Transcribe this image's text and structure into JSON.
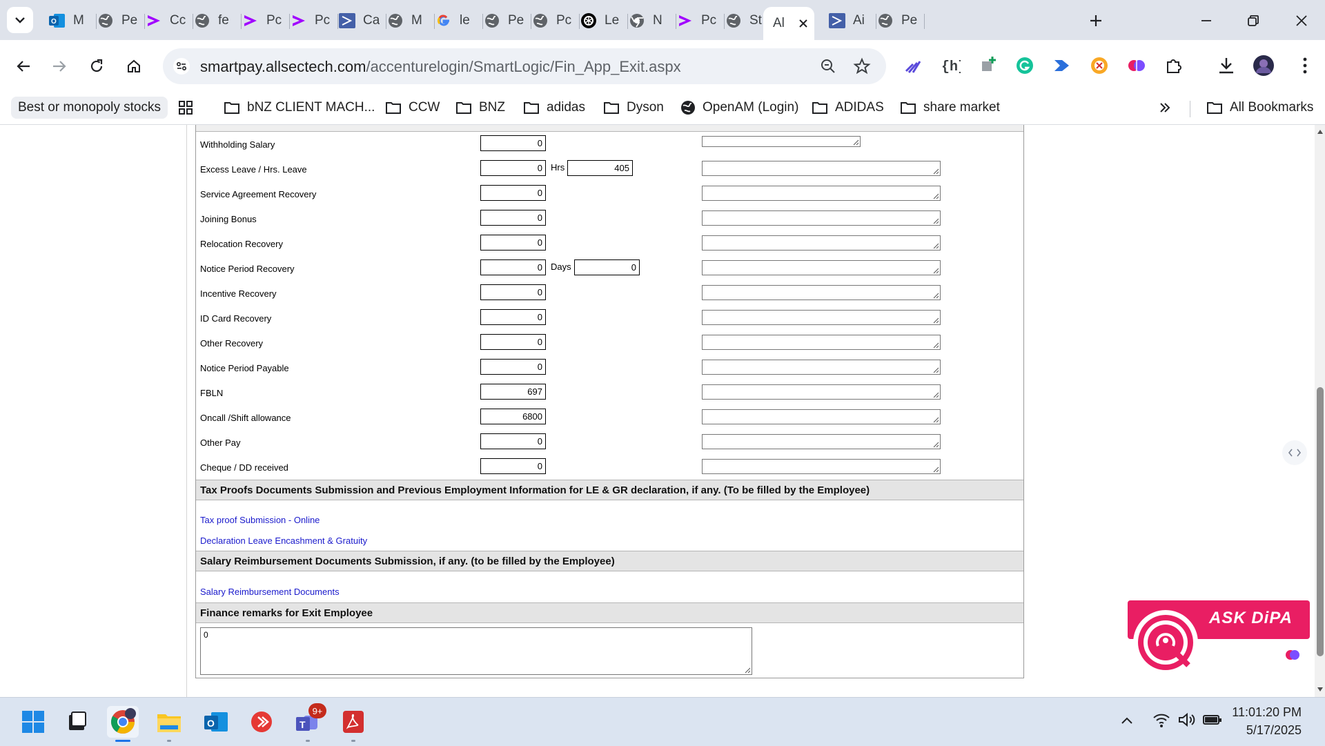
{
  "browser": {
    "tabs": [
      {
        "label": "M",
        "icon": "outlook-icon"
      },
      {
        "label": "Pe",
        "icon": "globe-icon"
      },
      {
        "label": "Cc",
        "icon": "accenture-icon"
      },
      {
        "label": "fe",
        "icon": "globe-icon"
      },
      {
        "label": "Pc",
        "icon": "accenture-icon"
      },
      {
        "label": "Pc",
        "icon": "accenture-icon"
      },
      {
        "label": "Ca",
        "icon": "powerapps-icon"
      },
      {
        "label": "M",
        "icon": "globe-icon"
      },
      {
        "label": "le",
        "icon": "google-icon"
      },
      {
        "label": "Pe",
        "icon": "globe-icon"
      },
      {
        "label": "Pc",
        "icon": "globe-icon"
      },
      {
        "label": "Le",
        "icon": "openai-icon"
      },
      {
        "label": "N",
        "icon": "chrome-gray-icon"
      },
      {
        "label": "Pc",
        "icon": "accenture-icon"
      },
      {
        "label": "St",
        "icon": "globe-icon"
      },
      {
        "label": "Al",
        "icon": "none",
        "active": true
      },
      {
        "label": "Ai",
        "icon": "powerapps-icon"
      },
      {
        "label": "Pe",
        "icon": "globe-icon"
      }
    ],
    "url_host": "smartpay.allsectech.com",
    "url_path": "/accenturelogin/SmartLogic/Fin_App_Exit.aspx"
  },
  "bookmarks": {
    "first": "Best or monopoly stocks",
    "items": [
      {
        "label": "bNZ CLIENT MACH...",
        "icon": "folder-icon"
      },
      {
        "label": "CCW",
        "icon": "folder-icon"
      },
      {
        "label": "BNZ",
        "icon": "folder-icon"
      },
      {
        "label": "adidas",
        "icon": "folder-icon"
      },
      {
        "label": "Dyson",
        "icon": "folder-icon"
      },
      {
        "label": "OpenAM (Login)",
        "icon": "globe-icon"
      },
      {
        "label": "ADIDAS",
        "icon": "folder-icon"
      },
      {
        "label": "share market",
        "icon": "folder-icon"
      }
    ],
    "all": "All Bookmarks"
  },
  "form": {
    "rows": [
      {
        "label": "Withholding Salary",
        "value": "0"
      },
      {
        "label": "Excess Leave / Hrs.   Leave",
        "value": "0",
        "extra_label": "Hrs",
        "extra_value": "405"
      },
      {
        "label": "Service Agreement Recovery",
        "value": "0"
      },
      {
        "label": "Joining Bonus",
        "value": "0"
      },
      {
        "label": "Relocation Recovery",
        "value": "0"
      },
      {
        "label": "Notice Period Recovery",
        "value": "0",
        "extra_label": "Days",
        "extra_value": "0"
      },
      {
        "label": "Incentive Recovery",
        "value": "0"
      },
      {
        "label": "ID Card Recovery",
        "value": "0"
      },
      {
        "label": "Other Recovery",
        "value": "0"
      },
      {
        "label": "Notice Period Payable",
        "value": "0"
      },
      {
        "label": "FBLN",
        "value": "697"
      },
      {
        "label": "Oncall /Shift allowance",
        "value": "6800"
      },
      {
        "label": "Other Pay",
        "value": "0"
      },
      {
        "label": "Cheque / DD received",
        "value": "0"
      }
    ],
    "tax_section_title": "Tax Proofs Documents Submission and Previous Employment Information for LE & GR declaration, if any. (To be filled by the Employee)",
    "tax_links": [
      "Tax proof Submission - Online",
      "Declaration Leave Encashment & Gratuity"
    ],
    "reimb_section_title": "Salary Reimbursement Documents Submission, if any. (to be filled by the Employee)",
    "reimb_link": "Salary Reimbursement Documents",
    "finance_title": "Finance remarks for Exit Employee",
    "finance_value": "0"
  },
  "dipa": {
    "label": "ASK DiPA",
    "color": "#e91e63"
  },
  "taskbar": {
    "teams_badge": "9+",
    "time": "11:01:20 PM",
    "date": "5/17/2025"
  }
}
